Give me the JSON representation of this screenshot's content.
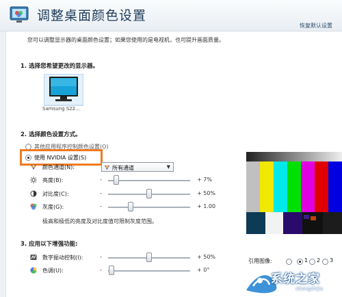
{
  "header": {
    "title": "调整桌面颜色设置",
    "restore_label": "恢复默认设置"
  },
  "description": "您可以调整显示器的桌面颜色设置；如果您使用的是电视机，也可提升画面质量。",
  "section1": {
    "heading": "1. 选择您希望更改的显示器。",
    "monitor_label": "Samsung S22..."
  },
  "section2": {
    "heading": "2. 选择颜色设置方式。",
    "option_app": "其他应用程序控制颜色设置(O)",
    "option_nvidia": "使用 NVIDIA 设置(S)",
    "channel_label": "颜色通道(N):",
    "channel_value": "所有通道",
    "brightness": {
      "label": "亮度(B):",
      "value": "+ 7%",
      "level": 0.07
    },
    "contrast": {
      "label": "对比度(C):",
      "value": "+ 50%",
      "level": 0.5
    },
    "gamma": {
      "label": "灰度(G):",
      "value": "+ 1.00",
      "level": 0.35
    },
    "note": "极高和极低的亮度及对比度值可限制灰度范围。"
  },
  "section3": {
    "heading": "3. 应用以下增强功能:",
    "vibrance": {
      "label": "数字振动控制(I):",
      "value": "+ 50%",
      "level": 0.5
    },
    "hue": {
      "label": "色调(U):",
      "value": "+ 0°",
      "level": 0.0
    }
  },
  "reference": {
    "label": "引用图像:",
    "options": [
      "1",
      "2",
      "3"
    ]
  },
  "watermark": {
    "text": "系统之家",
    "url": "xitongzhijia"
  },
  "colors": {
    "highlight": "#f07a1f",
    "title": "#1e3c5a"
  }
}
